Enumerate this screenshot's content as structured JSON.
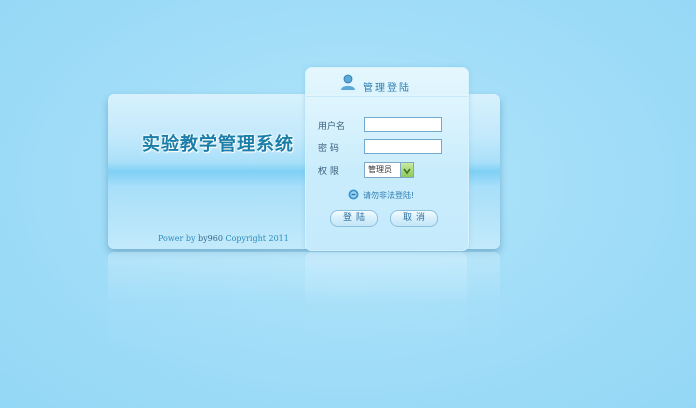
{
  "system": {
    "title": "实验教学管理系统"
  },
  "footer": {
    "copyright_pre": "Power by ",
    "copyright_author": "by960",
    "copyright_post": " Copyright 2011"
  },
  "login": {
    "header_title": "管理登陆",
    "username_label": "用户名",
    "password_label": "密 码",
    "role_label": "权 限",
    "username_value": "",
    "password_value": "",
    "role_selected": "管理员",
    "notice": "请勿非法登陆!",
    "login_button": "登陆",
    "cancel_button": "取消"
  },
  "icons": {
    "header": "user-icon",
    "notice": "info-icon",
    "select": "chevron-down-icon"
  },
  "colors": {
    "background": "#a3def8",
    "accent": "#2f7fb0",
    "title": "#1a7ea8",
    "select_button": "#8fcb5c"
  }
}
